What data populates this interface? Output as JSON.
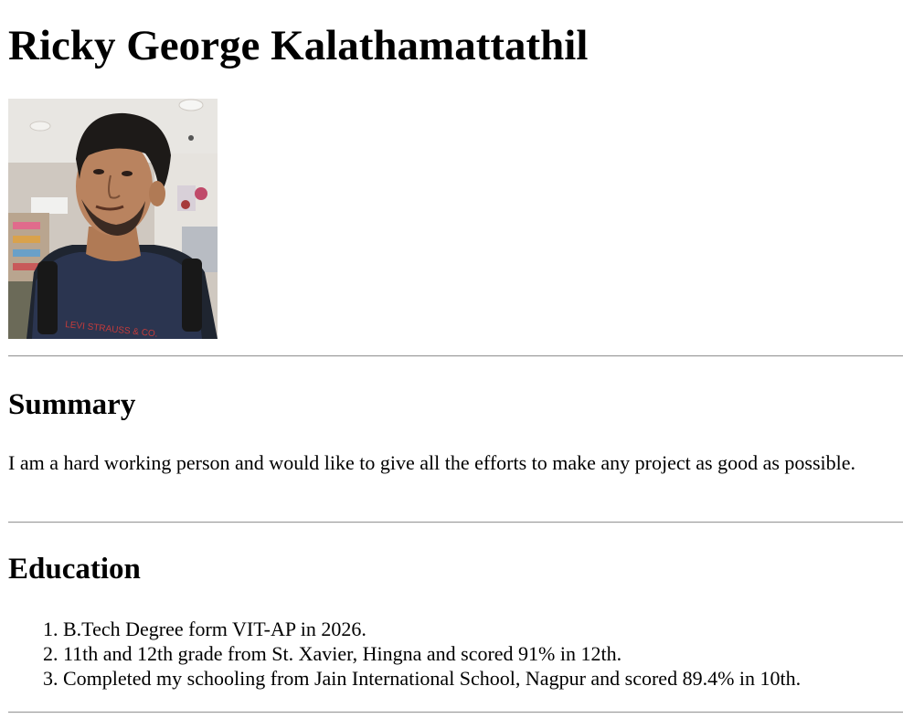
{
  "header": {
    "name": "Ricky George Kalathamattathil"
  },
  "photo": {
    "alt": "Ricky George Kalathamattathil",
    "shirt_text": "LEVI STRAUSS & CO."
  },
  "summary": {
    "heading": "Summary",
    "text": "I am a hard working person and would like to give all the efforts to make any project as good as possible."
  },
  "education": {
    "heading": "Education",
    "items": [
      "B.Tech Degree form VIT-AP in 2026.",
      "11th and 12th grade from St. Xavier, Hingna and scored 91% in 12th.",
      "Completed my schooling from Jain International School, Nagpur and scored 89.4% in 10th."
    ]
  }
}
